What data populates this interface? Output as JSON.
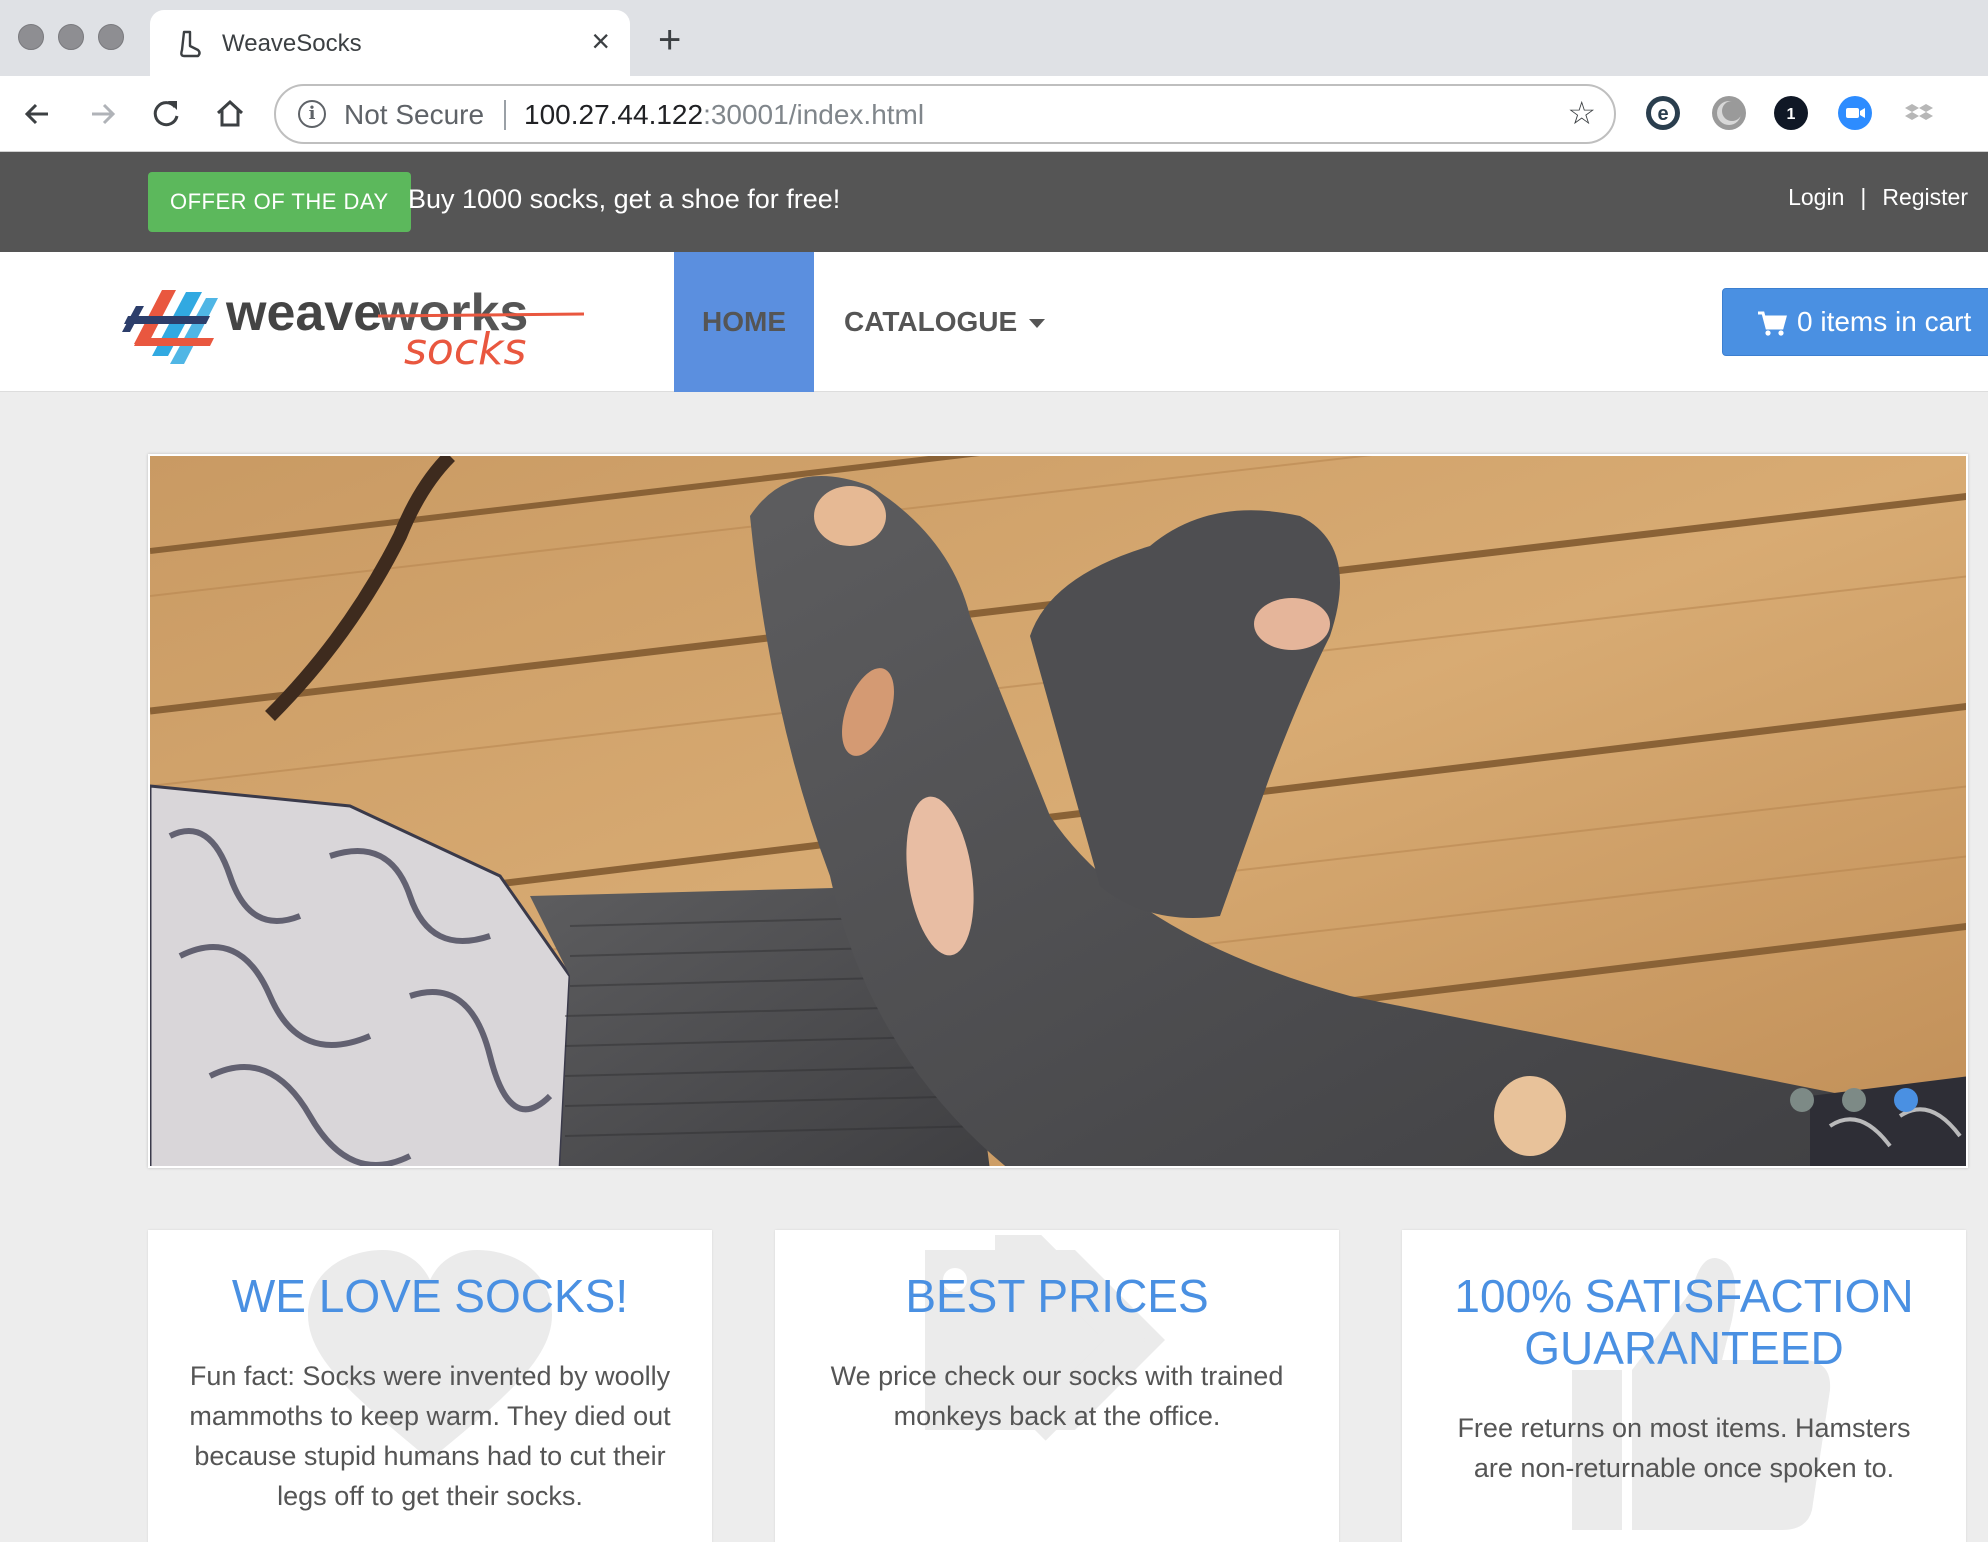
{
  "browser": {
    "tab_title": "WeaveSocks",
    "security_label": "Not Secure",
    "url_host": "100.27.44.122",
    "url_rest": ":30001/index.html"
  },
  "topbar": {
    "offer_badge": "OFFER OF THE DAY",
    "offer_text": "Buy 1000 socks, get a shoe for free!",
    "login": "Login",
    "separator": "|",
    "register": "Register"
  },
  "navbar": {
    "home": "HOME",
    "catalogue": "CATALOGUE",
    "cart": "0 items in cart"
  },
  "carousel": {
    "active_index": 2,
    "slide_count": 3
  },
  "features": [
    {
      "title": "WE LOVE SOCKS!",
      "text": "Fun fact: Socks were invented by woolly mammoths to keep warm. They died out because stupid humans had to cut their legs off to get their socks.",
      "icon": "heart-icon"
    },
    {
      "title": "BEST PRICES",
      "text": "We price check our socks with trained monkeys back at the office.",
      "icon": "tags-icon"
    },
    {
      "title": "100% SATISFACTION GUARANTEED",
      "text": "Free returns on most items. Hamsters are non-returnable once spoken to.",
      "icon": "thumbs-up-icon"
    }
  ],
  "colors": {
    "offer_green": "#5cb85c",
    "nav_active": "#5b8fdf",
    "cart_blue": "#4a90e2",
    "heading_blue": "#4a90e2",
    "topbar_gray": "#555555"
  }
}
